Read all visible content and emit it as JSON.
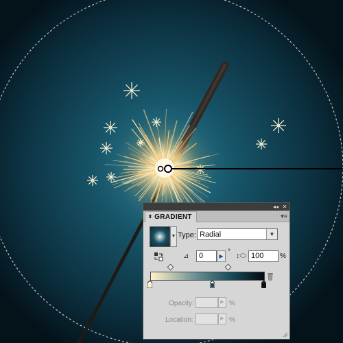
{
  "canvas": {
    "colors": {
      "background_center": "#1d5a6e",
      "background_edge": "#04121a",
      "selection_ring": "#ffffff",
      "stick": "#2a2420",
      "spark_core": "#fff6d6",
      "spark_warm": "#f2c878"
    },
    "annotation": {
      "description_icon": "gradient-origin-handle"
    }
  },
  "panel": {
    "tab_title": "GRADIENT",
    "tab_arrows": "⬍",
    "menu_icon": "▾≡",
    "collapse_icon": "◂◂",
    "close_icon": "✕",
    "type_label": "Type:",
    "type_value": "Radial",
    "angle_value": "0",
    "degree_symbol": "°",
    "aspect_value": "100",
    "percent_symbol": "%",
    "opacity_label": "Opacity:",
    "location_label": "Location:",
    "stops": {
      "colors": [
        "#fff4c8",
        "#1a4d5c",
        "#020a10"
      ],
      "locations_percent": [
        0,
        50,
        100
      ],
      "midpoints_percent": [
        20,
        69
      ]
    }
  }
}
